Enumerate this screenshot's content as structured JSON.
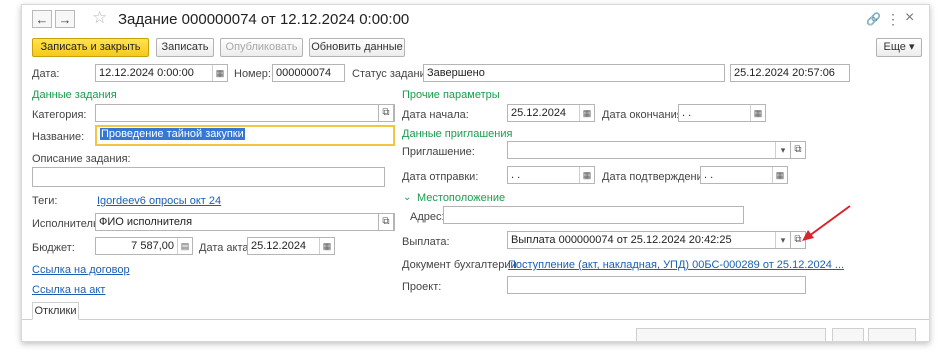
{
  "header": {
    "back": "←",
    "forward": "→",
    "star": "☆",
    "title": "Задание 000000074 от 12.12.2024 0:00:00",
    "link_icon": "🔗",
    "menu_icon": "⋮",
    "close_icon": "×"
  },
  "toolbar": {
    "save_close": "Записать и закрыть",
    "save": "Записать",
    "publish": "Опубликовать",
    "refresh": "Обновить данные",
    "more": "Еще ▾"
  },
  "top": {
    "date_label": "Дата:",
    "date_value": "12.12.2024  0:00:00",
    "number_label": "Номер:",
    "number_value": "000000074",
    "status_label": "Статус задания:",
    "status_value": "Завершено",
    "status_date": "25.12.2024 20:57:06"
  },
  "left": {
    "section": "Данные задания",
    "category_label": "Категория:",
    "category_value": "",
    "name_label": "Название:",
    "name_value": "Проведение тайной закупки",
    "description_label": "Описание задания:",
    "description_value": "",
    "tags_label": "Теги:",
    "tags_value": "Igordeev6 опросы окт 24",
    "executor_label": "Исполнитель:",
    "executor_value": "ФИО исполнителя",
    "budget_label": "Бюджет:",
    "budget_value": "7 587,00",
    "act_date_label": "Дата акта:",
    "act_date_value": "25.12.2024",
    "contract_link": "Ссылка на договор",
    "act_link": "Ссылка на акт"
  },
  "right": {
    "other_section": "Прочие параметры",
    "start_label": "Дата начала:",
    "start_value": "25.12.2024",
    "end_label": "Дата окончания:",
    "end_value": " .  .",
    "invite_section": "Данные приглашения",
    "invite_label": "Приглашение:",
    "invite_value": "",
    "send_label": "Дата отправки:",
    "send_value": " .  .",
    "confirm_label": "Дата подтверждения:",
    "confirm_value": " .  .",
    "location_section": "Местоположение",
    "address_label": "Адрес:",
    "address_value": "",
    "payment_label": "Выплата:",
    "payment_value": "Выплата 000000074 от 25.12.2024 20:42:25",
    "accounting_label": "Документ бухгалтерии:",
    "accounting_value": "Поступление (акт, накладная, УПД) 00БС-000289 от 25.12.2024 ...",
    "project_label": "Проект:",
    "project_value": ""
  },
  "tabs": {
    "responses": "Отклики"
  },
  "colors": {
    "accent_green": "#1a9c4f",
    "link_blue": "#1a5fb4",
    "primary_yellow": "#f5c91c",
    "arrow_red": "#d9232e"
  }
}
